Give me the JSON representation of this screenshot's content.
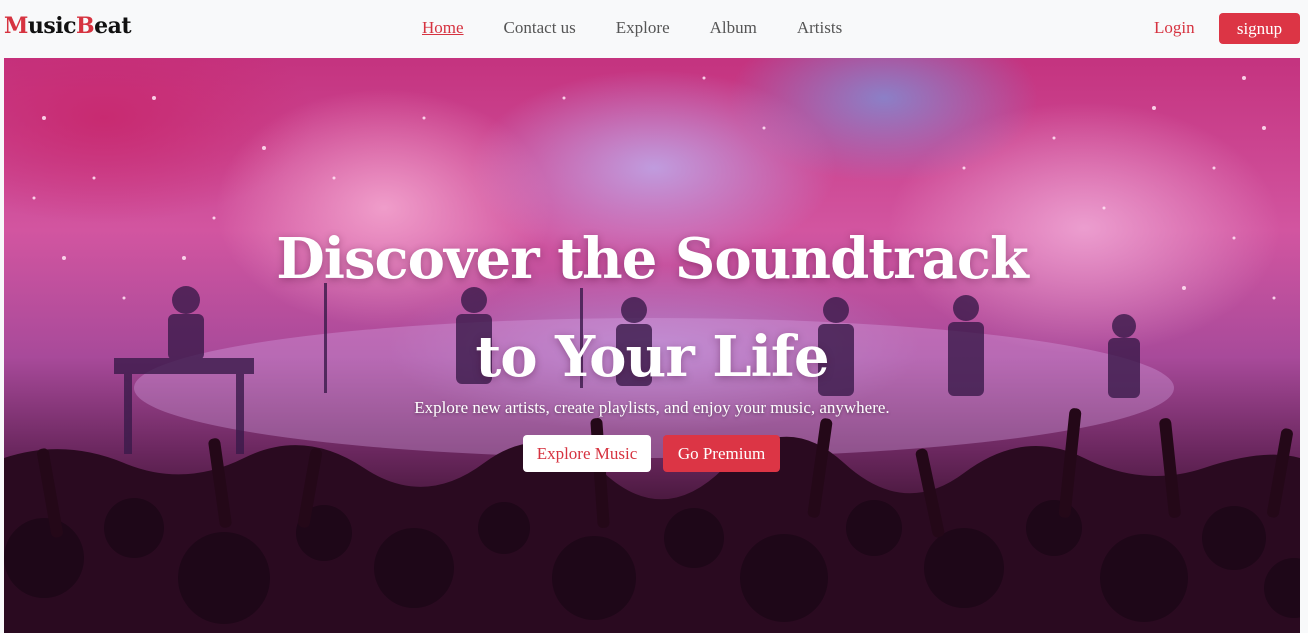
{
  "brand": {
    "part1_letter": "M",
    "part1_rest": "usic",
    "part2_letter": "B",
    "part2_rest": "eat"
  },
  "nav": {
    "items": [
      {
        "label": "Home",
        "active": true
      },
      {
        "label": "Contact us",
        "active": false
      },
      {
        "label": "Explore",
        "active": false
      },
      {
        "label": "Album",
        "active": false
      },
      {
        "label": "Artists",
        "active": false
      }
    ],
    "login_label": "Login",
    "signup_label": "signup"
  },
  "hero": {
    "title_line1": "Discover the Soundtrack",
    "title_line2": "to Your Life",
    "subtitle": "Explore new artists, create playlists, and enjoy your music, anywhere.",
    "explore_button": "Explore Music",
    "premium_button": "Go Premium"
  },
  "colors": {
    "accent": "#dc3545",
    "brand_accent": "#d63340",
    "navbar_bg": "#f8f9fa"
  }
}
